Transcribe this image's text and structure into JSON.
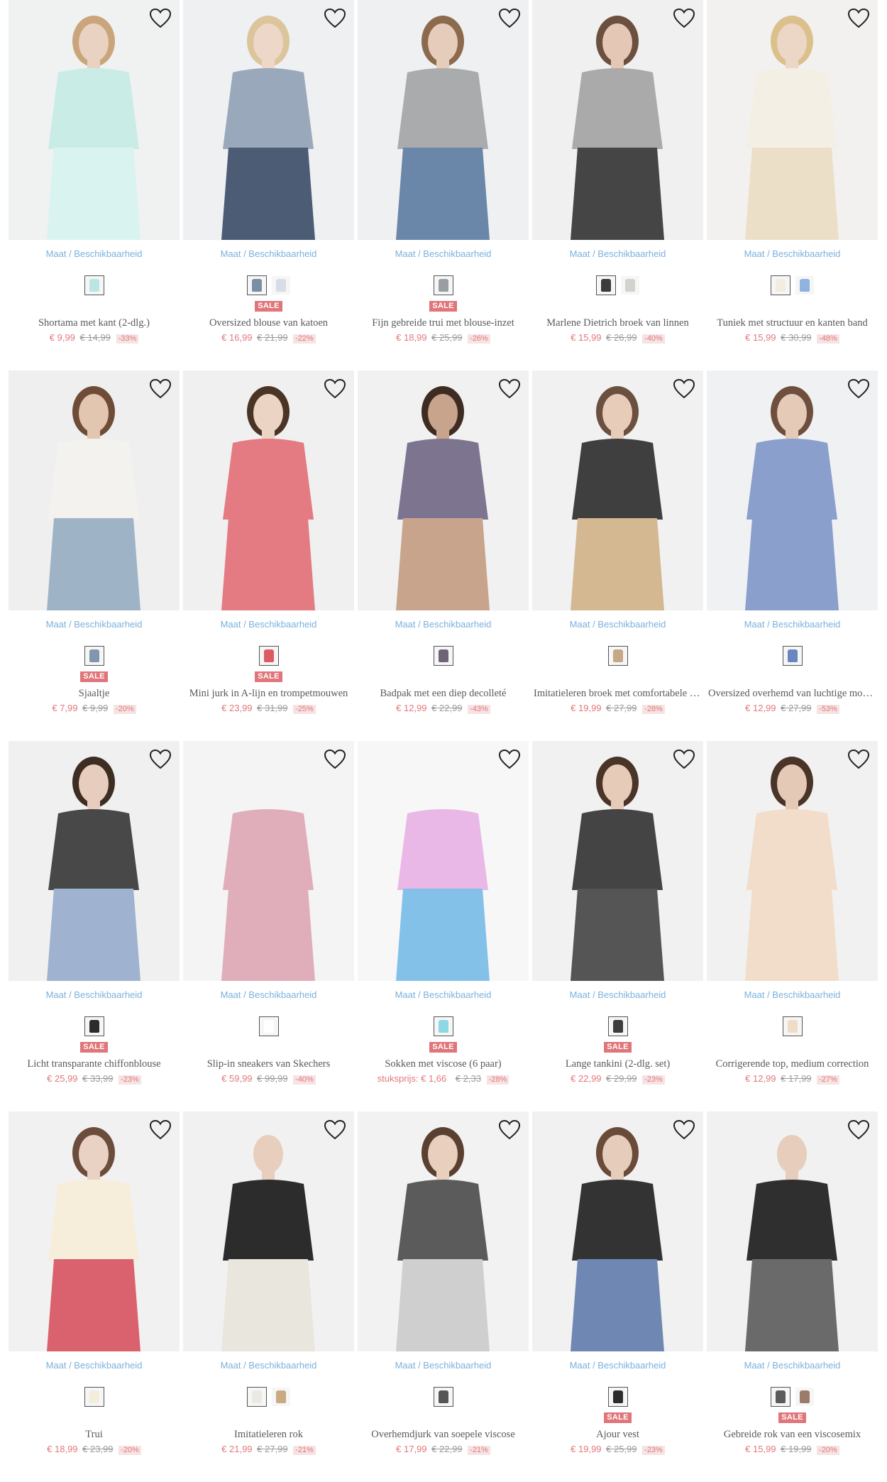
{
  "wishlist_icon": "heart-outline-icon",
  "colors": {
    "link": "#7ab1dd",
    "price": "#e2787b",
    "badge": "#e0757a",
    "old_price": "#9b9b9b"
  },
  "products": [
    {
      "size_link": "Maat / Beschikbaarheid",
      "swatches": [
        "#b9e6e2"
      ],
      "sale": "",
      "name": "Shortama met kant (2-dlg.)",
      "price": "€ 9,99",
      "old_price": "€ 14,99",
      "discount": "-33%",
      "unit": "",
      "art": {
        "bg": "#eff2f1",
        "top": "#c9ece7",
        "bottom": "#d9f3f0",
        "skin": "#e9d2c2",
        "hair": "#caa57c"
      }
    },
    {
      "size_link": "Maat / Beschikbaarheid",
      "swatches": [
        "#7a8ea6",
        "#d6dde6"
      ],
      "sale": "SALE",
      "name": "Oversized blouse van katoen",
      "price": "€ 16,99",
      "old_price": "€ 21,99",
      "discount": "-22%",
      "unit": "",
      "art": {
        "bg": "#eef0f2",
        "top": "#9aa8bb",
        "bottom": "#4b5c74",
        "skin": "#ecd7c8",
        "hair": "#dcc59a"
      }
    },
    {
      "size_link": "Maat / Beschikbaarheid",
      "swatches": [
        "#9a9ea3"
      ],
      "sale": "SALE",
      "name": "Fijn gebreide trui met blouse-inzet",
      "price": "€ 18,99",
      "old_price": "€ 25,99",
      "discount": "-26%",
      "unit": "",
      "art": {
        "bg": "#eff0f1",
        "top": "#a9abad",
        "bottom": "#6a86a9",
        "skin": "#e6cdbb",
        "hair": "#8c6a4e"
      }
    },
    {
      "size_link": "Maat / Beschikbaarheid",
      "swatches": [
        "#3c3c3c",
        "#d3d2cc"
      ],
      "sale": "",
      "name": "Marlene Dietrich broek van linnen",
      "price": "€ 15,99",
      "old_price": "€ 26,99",
      "discount": "-40%",
      "unit": "",
      "art": {
        "bg": "#f0f0f0",
        "top": "#aaaaaa",
        "bottom": "#454545",
        "skin": "#e4c7b4",
        "hair": "#6b5040"
      }
    },
    {
      "size_link": "Maat / Beschikbaarheid",
      "swatches": [
        "#f3ede1",
        "#8fb3de"
      ],
      "sale": "",
      "name": "Tuniek met structuur en kanten band",
      "price": "€ 15,99",
      "old_price": "€ 30,99",
      "discount": "-48%",
      "unit": "",
      "art": {
        "bg": "#f2f1ef",
        "top": "#f4efe4",
        "bottom": "#ecdfc8",
        "skin": "#ecd6c6",
        "hair": "#dcc08c"
      }
    },
    {
      "size_link": "Maat / Beschikbaarheid",
      "swatches": [
        "#7f96ad"
      ],
      "sale": "SALE",
      "name": "Sjaaltje",
      "price": "€ 7,99",
      "old_price": "€ 9,99",
      "discount": "-20%",
      "unit": "",
      "art": {
        "bg": "#efefef",
        "top": "#f4f2ee",
        "bottom": "#9fb3c6",
        "skin": "#e3c6b0",
        "hair": "#6f4c37"
      }
    },
    {
      "size_link": "Maat / Beschikbaarheid",
      "swatches": [
        "#df5b64"
      ],
      "sale": "SALE",
      "name": "Mini jurk in A-lijn en trompetmouwen",
      "price": "€ 23,99",
      "old_price": "€ 31,99",
      "discount": "-25%",
      "unit": "",
      "art": {
        "bg": "#f0f0f0",
        "top": "#e47a82",
        "bottom": "#e47a82",
        "skin": "#ecd4c4",
        "hair": "#4a3426"
      }
    },
    {
      "size_link": "Maat / Beschikbaarheid",
      "swatches": [
        "#6d6478"
      ],
      "sale": "",
      "name": "Badpak met een diep decolleté",
      "price": "€ 12,99",
      "old_price": "€ 22,99",
      "discount": "-43%",
      "unit": "",
      "art": {
        "bg": "#f1f1f1",
        "top": "#7d7590",
        "bottom": "#c9a48c",
        "skin": "#c9a48c",
        "hair": "#3e2c22"
      }
    },
    {
      "size_link": "Maat / Beschikbaarheid",
      "swatches": [
        "#c6a886"
      ],
      "sale": "",
      "name": "Imitatieleren broek met comfortabele band",
      "price": "€ 19,99",
      "old_price": "€ 27,99",
      "discount": "-28%",
      "unit": "",
      "art": {
        "bg": "#f1f1f1",
        "top": "#3f3f3f",
        "bottom": "#d4b892",
        "skin": "#e7cdb9",
        "hair": "#6b5040"
      }
    },
    {
      "size_link": "Maat / Beschikbaarheid",
      "swatches": [
        "#6a86bf"
      ],
      "sale": "",
      "name": "Oversized overhemd van luchtige mousseline",
      "price": "€ 12,99",
      "old_price": "€ 27,99",
      "discount": "-53%",
      "unit": "",
      "art": {
        "bg": "#f0f1f3",
        "top": "#8a9fcc",
        "bottom": "#8a9fcc",
        "skin": "#e5cab7",
        "hair": "#6e4f3d"
      }
    },
    {
      "size_link": "Maat / Beschikbaarheid",
      "swatches": [
        "#2c2c2c"
      ],
      "sale": "SALE",
      "name": "Licht transparante chiffonblouse",
      "price": "€ 25,99",
      "old_price": "€ 33,99",
      "discount": "-23%",
      "unit": "",
      "art": {
        "bg": "#f0f0f0",
        "top": "#484848",
        "bottom": "#9fb2cf",
        "skin": "#e7cdbd",
        "hair": "#3d2d23"
      }
    },
    {
      "size_link": "Maat / Beschikbaarheid",
      "swatches": [
        "#ffffff"
      ],
      "sale": "",
      "name": "Slip-in sneakers van Skechers",
      "price": "€ 59,99",
      "old_price": "€ 99,99",
      "discount": "-40%",
      "unit": "",
      "art": {
        "bg": "#f4f4f4",
        "top": "#e0aebb",
        "bottom": "#e0aebb",
        "skin": "#f4f4f4",
        "hair": "#f4f4f4"
      }
    },
    {
      "size_link": "Maat / Beschikbaarheid",
      "swatches": [
        "#8ed8e6"
      ],
      "sale": "SALE",
      "name": "Sokken met viscose (6 paar)",
      "price": "",
      "old_price": "€ 2,33",
      "discount": "-28%",
      "unit": "stuksprijs: € 1,66",
      "art": {
        "bg": "#f7f7f7",
        "top": "#e9b8e6",
        "bottom": "#84c1e9",
        "skin": "#f7f7f7",
        "hair": "#f7f7f7"
      }
    },
    {
      "size_link": "Maat / Beschikbaarheid",
      "swatches": [
        "#3d3d3d"
      ],
      "sale": "SALE",
      "name": "Lange tankini (2-dlg. set)",
      "price": "€ 22,99",
      "old_price": "€ 29,99",
      "discount": "-23%",
      "unit": "",
      "art": {
        "bg": "#f1f1f1",
        "top": "#444444",
        "bottom": "#555555",
        "skin": "#e6cbb8",
        "hair": "#4a3428"
      }
    },
    {
      "size_link": "Maat / Beschikbaarheid",
      "swatches": [
        "#f1dcc8"
      ],
      "sale": "",
      "name": "Corrigerende top, medium correction",
      "price": "€ 12,99",
      "old_price": "€ 17,99",
      "discount": "-27%",
      "unit": "",
      "art": {
        "bg": "#f1f1f1",
        "top": "#f1ddca",
        "bottom": "#f1ddca",
        "skin": "#e4c9b6",
        "hair": "#4a3428"
      }
    },
    {
      "size_link": "Maat / Beschikbaarheid",
      "swatches": [
        "#f5eddc"
      ],
      "sale": "",
      "name": "Trui",
      "price": "€ 18,99",
      "old_price": "€ 23,99",
      "discount": "-20%",
      "unit": "",
      "art": {
        "bg": "#f1f1f1",
        "top": "#f6eedb",
        "bottom": "#d9626e",
        "skin": "#e9d2c4",
        "hair": "#6c4d3c"
      }
    },
    {
      "size_link": "Maat / Beschikbaarheid",
      "swatches": [
        "#ece9e2",
        "#c8ab82"
      ],
      "sale": "",
      "name": "Imitatieleren rok",
      "price": "€ 21,99",
      "old_price": "€ 27,99",
      "discount": "-21%",
      "unit": "",
      "art": {
        "bg": "#f1f1f1",
        "top": "#2c2c2c",
        "bottom": "#e9e6de",
        "skin": "#e7cebd",
        "hair": "#f1f1f1"
      }
    },
    {
      "size_link": "Maat / Beschikbaarheid",
      "swatches": [
        "#555555"
      ],
      "sale": "",
      "name": "Overhemdjurk van soepele viscose",
      "price": "€ 17,99",
      "old_price": "€ 22,99",
      "discount": "-21%",
      "unit": "",
      "art": {
        "bg": "#f2f2f2",
        "top": "#5b5b5b",
        "bottom": "#cfcfcf",
        "skin": "#e8cfbe",
        "hair": "#5a4030"
      }
    },
    {
      "size_link": "Maat / Beschikbaarheid",
      "swatches": [
        "#2d2d2d"
      ],
      "sale": "SALE",
      "name": "Ajour vest",
      "price": "€ 19,99",
      "old_price": "€ 25,99",
      "discount": "-23%",
      "unit": "",
      "art": {
        "bg": "#f1f1f1",
        "top": "#333333",
        "bottom": "#6f88b3",
        "skin": "#e6ccba",
        "hair": "#6a4a38"
      }
    },
    {
      "size_link": "Maat / Beschikbaarheid",
      "swatches": [
        "#5b5b5b",
        "#9a7b6c"
      ],
      "sale": "SALE",
      "name": "Gebreide rok van een viscosemix",
      "price": "€ 15,99",
      "old_price": "€ 19,99",
      "discount": "-20%",
      "unit": "",
      "art": {
        "bg": "#f1f1f1",
        "top": "#2f2f2f",
        "bottom": "#6a6a6a",
        "skin": "#e7cdbc",
        "hair": "#f1f1f1"
      }
    }
  ]
}
